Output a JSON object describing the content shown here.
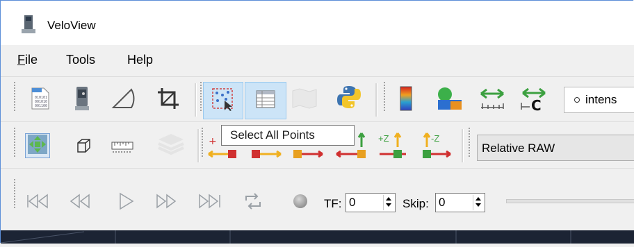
{
  "window": {
    "title": "VeloView"
  },
  "menu": {
    "file": "ile",
    "file_mnemonic": "F",
    "tools": "Tools",
    "help": "Help"
  },
  "toolbar1": {
    "icons": [
      "open-pcap-icon",
      "sensor-stream-icon",
      "calibration-protractor-icon",
      "crop-icon",
      "select-points-icon",
      "spreadsheet-icon",
      "map-icon",
      "python-shell-icon",
      "color-legend-icon",
      "scalar-color-icon",
      "measure-distance-icon",
      "measure-c-icon"
    ],
    "color_by_value": "intens"
  },
  "toolbar2": {
    "icons": [
      "reset-camera-icon",
      "cube-view-icon",
      "ruler-icon",
      "layers-icon",
      "view-plus-x-icon",
      "view-minus-x-icon",
      "view-plus-y-icon",
      "view-minus-y-icon",
      "view-plus-z-icon",
      "view-minus-z-icon"
    ],
    "axis_labels": {
      "plus_z": "+Z",
      "minus_z": "-Z",
      "plus": "+"
    },
    "mode_value": "Relative RAW"
  },
  "tooltip": {
    "text": "Select All Points"
  },
  "playback": {
    "tf_label": "TF:",
    "tf_value": "0",
    "skip_label": "Skip:",
    "skip_value": "0"
  },
  "colors": {
    "accent": "#cce4f7",
    "viewport": "#1c2434"
  }
}
